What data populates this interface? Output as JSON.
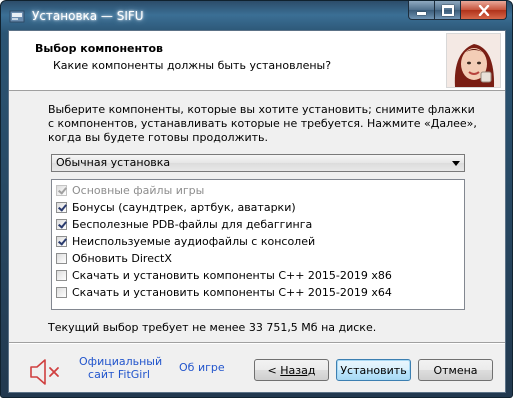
{
  "window": {
    "title": "Установка — SIFU"
  },
  "header": {
    "title": "Выбор компонентов",
    "subtitle": "Какие компоненты должны быть установлены?"
  },
  "main": {
    "description": "Выберите компоненты, которые вы хотите установить; снимите флажки с компонентов, устанавливать которые не требуется. Нажмите «Далее», когда вы будете готовы продолжить.",
    "install_type": "Обычная установка",
    "components": [
      {
        "label": "Основные файлы игры",
        "checked": true,
        "disabled": true
      },
      {
        "label": "Бонусы (саундтрек, артбук, аватарки)",
        "checked": true,
        "disabled": false
      },
      {
        "label": "Бесполезные PDB-файлы для дебаггинга",
        "checked": true,
        "disabled": false
      },
      {
        "label": "Неиспользуемые аудиофайлы с консолей",
        "checked": true,
        "disabled": false
      },
      {
        "label": "Обновить DirectX",
        "checked": false,
        "disabled": false
      },
      {
        "label": "Скачать и установить компоненты C++ 2015-2019 x86",
        "checked": false,
        "disabled": false
      },
      {
        "label": "Скачать и установить компоненты C++ 2015-2019 x64",
        "checked": false,
        "disabled": false
      }
    ],
    "space_required": "Текущий выбор требует не менее 33 751,5 Мб на диске."
  },
  "footer": {
    "fitgirl_link_line1": "Официальный",
    "fitgirl_link_line2": "сайт FitGirl",
    "about_link": "Об игре",
    "back_prefix": "< ",
    "back_label": "Назад",
    "install_label": "Установить",
    "cancel_label": "Отмена"
  },
  "colors": {
    "link": "#2255cc",
    "mute_icon": "#d04040"
  }
}
